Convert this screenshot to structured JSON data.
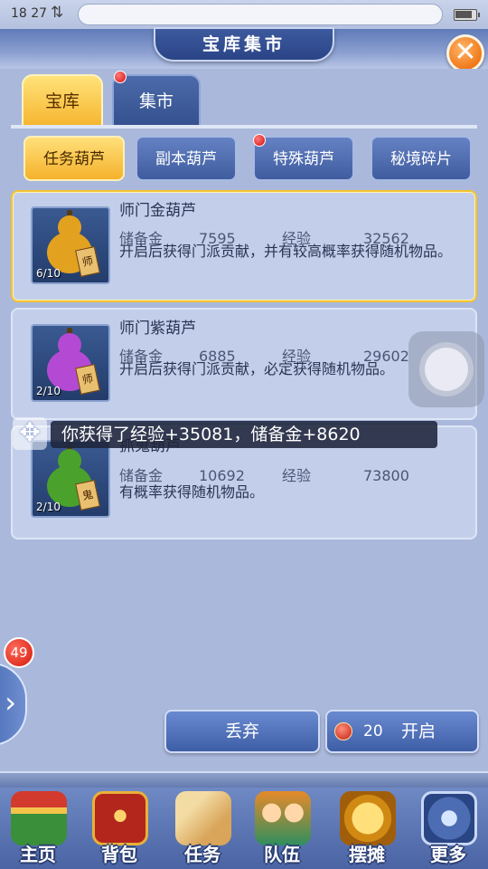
{
  "status_bar": {
    "time": "18 27",
    "arrows": "⇅"
  },
  "window": {
    "title": "宝库集市",
    "close_glyph": "✕"
  },
  "tabs": [
    {
      "label": "宝库",
      "active": true,
      "red_dot": false
    },
    {
      "label": "集市",
      "active": false,
      "red_dot": true
    }
  ],
  "subtabs": [
    {
      "label": "任务葫芦",
      "active": true,
      "red_dot": false
    },
    {
      "label": "副本葫芦",
      "active": false,
      "red_dot": false
    },
    {
      "label": "特殊葫芦",
      "active": false,
      "red_dot": true
    },
    {
      "label": "秘境碎片",
      "active": false,
      "red_dot": false
    }
  ],
  "items": [
    {
      "name": "师门金葫芦",
      "reserve_label": "储备金",
      "reserve_value": "7595",
      "exp_label": "经验",
      "exp_value": "32562",
      "description": "开启后获得门派贡献，并有较高概率获得随机物品。",
      "count": "6/10",
      "tag": "师",
      "gourd_color": "#e2a21f",
      "selected": true
    },
    {
      "name": "师门紫葫芦",
      "reserve_label": "储备金",
      "reserve_value": "6885",
      "exp_label": "经验",
      "exp_value": "29602",
      "description": "开启后获得门派贡献，必定获得随机物品。",
      "count": "2/10",
      "tag": "师",
      "gourd_color": "#b44ad3",
      "selected": false
    },
    {
      "name": "抓鬼葫芦",
      "reserve_label": "储备金",
      "reserve_value": "10692",
      "exp_label": "经验",
      "exp_value": "73800",
      "description": "有概率获得随机物品。",
      "count": "2/10",
      "tag": "鬼",
      "gourd_color": "#4aa12c",
      "selected": false
    }
  ],
  "toast": {
    "text": "你获得了经验+35081，储备金+8620"
  },
  "side_badge": "49",
  "actions": {
    "discard_label": "丢弃",
    "open_count": "20",
    "open_label": "开启"
  },
  "nav": [
    {
      "label": "主页",
      "icon": "home-icon"
    },
    {
      "label": "背包",
      "icon": "bag-icon"
    },
    {
      "label": "任务",
      "icon": "task-icon"
    },
    {
      "label": "队伍",
      "icon": "team-icon"
    },
    {
      "label": "摆摊",
      "icon": "stall-icon"
    },
    {
      "label": "更多",
      "icon": "more-icon"
    }
  ]
}
